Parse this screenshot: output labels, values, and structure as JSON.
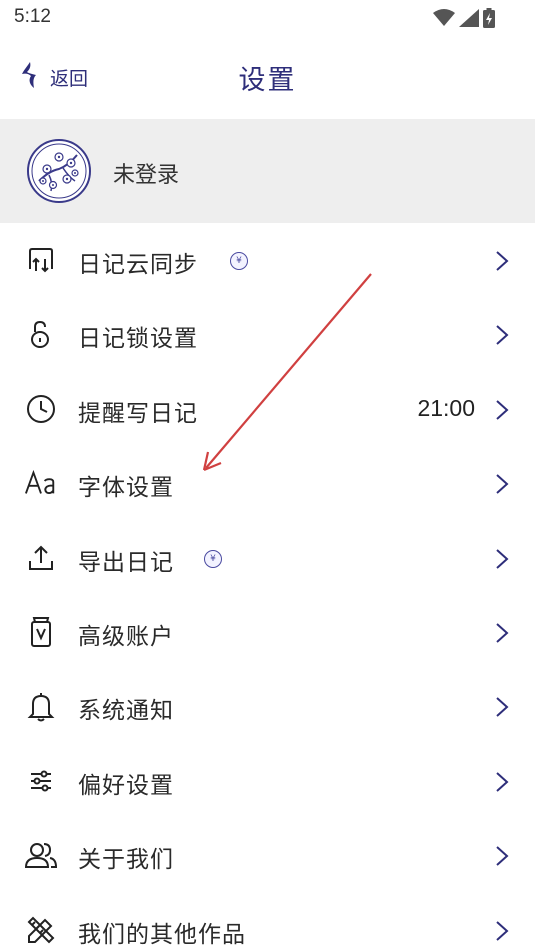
{
  "status_bar": {
    "time": "5:12"
  },
  "header": {
    "back_label": "返回",
    "title": "设置"
  },
  "account": {
    "label": "未登录"
  },
  "menu": {
    "items": [
      {
        "label": "日记云同步",
        "icon": "cloud-sync-icon",
        "vip": true,
        "value": ""
      },
      {
        "label": "日记锁设置",
        "icon": "lock-icon",
        "vip": false,
        "value": ""
      },
      {
        "label": "提醒写日记",
        "icon": "clock-icon",
        "vip": false,
        "value": "21:00"
      },
      {
        "label": "字体设置",
        "icon": "font-icon",
        "vip": false,
        "value": ""
      },
      {
        "label": "导出日记",
        "icon": "export-icon",
        "vip": true,
        "value": ""
      },
      {
        "label": "高级账户",
        "icon": "premium-account-icon",
        "vip": false,
        "value": ""
      },
      {
        "label": "系统通知",
        "icon": "bell-icon",
        "vip": false,
        "value": ""
      },
      {
        "label": "偏好设置",
        "icon": "sliders-icon",
        "vip": false,
        "value": ""
      },
      {
        "label": "关于我们",
        "icon": "people-icon",
        "vip": false,
        "value": ""
      },
      {
        "label": "我们的其他作品",
        "icon": "tools-icon",
        "vip": false,
        "value": ""
      }
    ],
    "vip_symbol": "¥"
  },
  "colors": {
    "accent": "#2e2e7a",
    "account_bg": "#eeeeee",
    "annotation_arrow": "#d04040"
  }
}
